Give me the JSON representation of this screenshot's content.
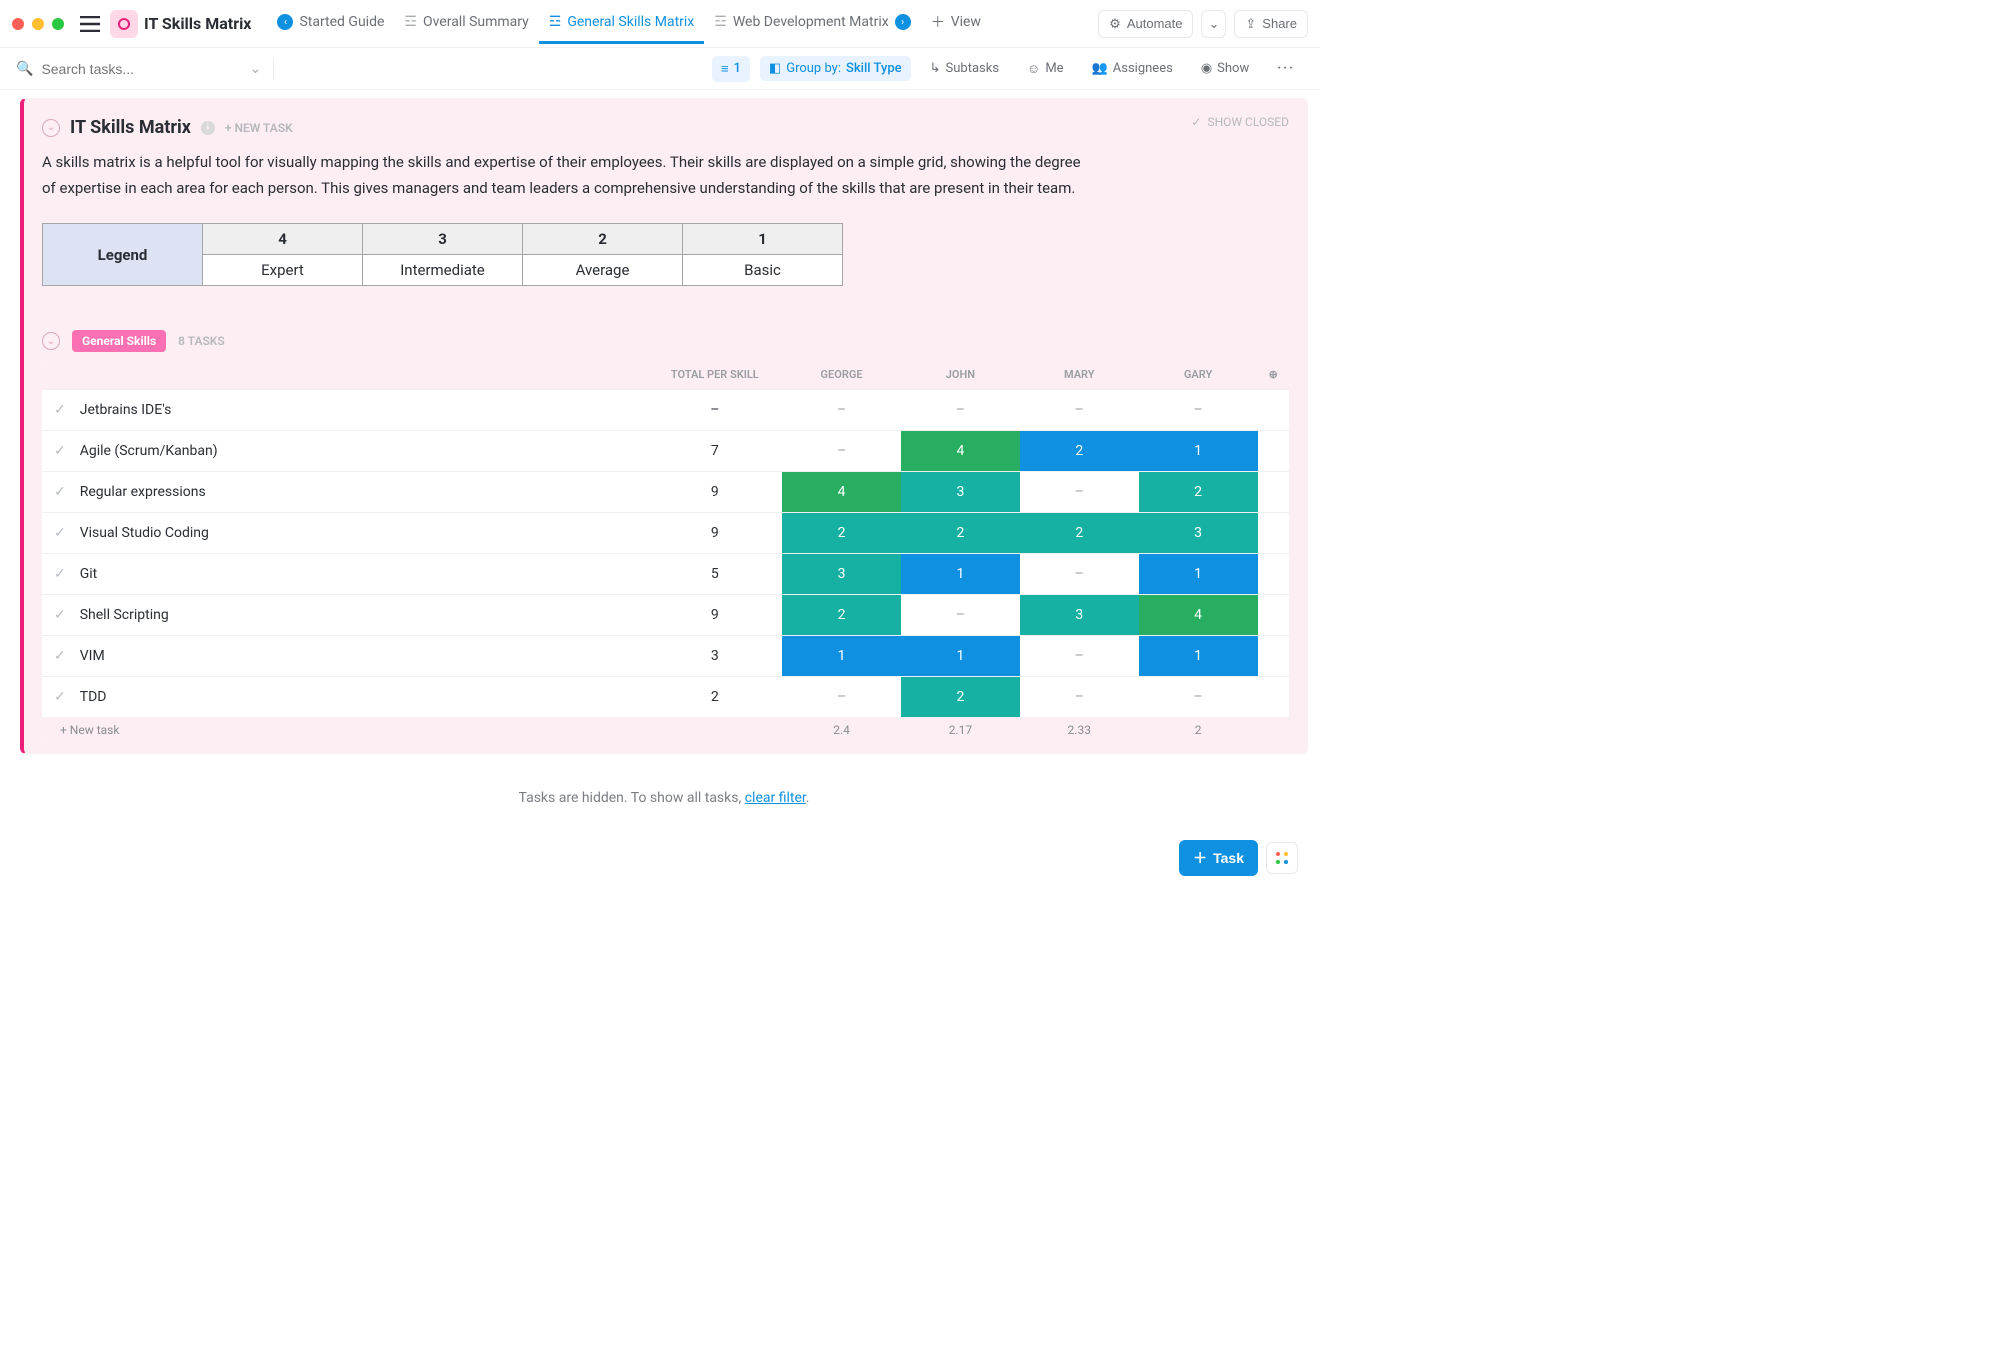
{
  "window": {
    "title": "IT Skills Matrix"
  },
  "tabs": {
    "started_guide": "Started Guide",
    "overall_summary": "Overall Summary",
    "general_skills_matrix": "General Skills Matrix",
    "web_dev_matrix": "Web Development Matrix",
    "view": "View"
  },
  "toolbar": {
    "automate": "Automate",
    "share": "Share"
  },
  "filters": {
    "search_placeholder": "Search tasks...",
    "filter_count": "1",
    "group_by_label": "Group by:",
    "group_by_value": "Skill Type",
    "subtasks": "Subtasks",
    "me": "Me",
    "assignees": "Assignees",
    "show": "Show"
  },
  "panel": {
    "title": "IT Skills Matrix",
    "new_task": "+ NEW TASK",
    "show_closed": "SHOW CLOSED",
    "description": "A skills matrix is a helpful tool for visually mapping the skills and expertise of their employees. Their skills are displayed on a simple grid, showing the degree of expertise in each area for each person. This gives managers and team leaders a comprehensive understanding of the skills that are present in their team."
  },
  "legend": {
    "header": "Legend",
    "levels": [
      {
        "num": "4",
        "label": "Expert"
      },
      {
        "num": "3",
        "label": "Intermediate"
      },
      {
        "num": "2",
        "label": "Average"
      },
      {
        "num": "1",
        "label": "Basic"
      }
    ]
  },
  "colors": {
    "green": "#27ae60",
    "teal": "#17b1a4",
    "blue": "#1090e0",
    "accent_pink": "#ec1e79"
  },
  "skills_section": {
    "badge": "General Skills",
    "count_label": "8 TASKS",
    "columns": {
      "total": "TOTAL PER SKILL",
      "people": [
        "GEORGE",
        "JOHN",
        "MARY",
        "GARY"
      ]
    },
    "rows": [
      {
        "name": "Jetbrains IDE's",
        "total": "–",
        "cells": [
          null,
          null,
          null,
          null
        ]
      },
      {
        "name": "Agile (Scrum/Kanban)",
        "total": "7",
        "cells": [
          null,
          4,
          2,
          1
        ]
      },
      {
        "name": "Regular expressions",
        "total": "9",
        "cells": [
          4,
          3,
          null,
          2
        ]
      },
      {
        "name": "Visual Studio Coding",
        "total": "9",
        "cells": [
          2,
          2,
          2,
          3
        ]
      },
      {
        "name": "Git",
        "total": "5",
        "cells": [
          3,
          1,
          null,
          1
        ]
      },
      {
        "name": "Shell Scripting",
        "total": "9",
        "cells": [
          2,
          null,
          3,
          4
        ]
      },
      {
        "name": "VIM",
        "total": "3",
        "cells": [
          1,
          1,
          null,
          1
        ]
      },
      {
        "name": "TDD",
        "total": "2",
        "cells": [
          null,
          2,
          null,
          null
        ]
      }
    ],
    "footer": {
      "new_task": "+ New task",
      "avgs": [
        "2.4",
        "2.17",
        "2.33",
        "2"
      ]
    }
  },
  "hidden_note": {
    "prefix": "Tasks are hidden. To show all tasks, ",
    "link": "clear filter",
    "suffix": "."
  },
  "fab": {
    "task": "Task"
  }
}
